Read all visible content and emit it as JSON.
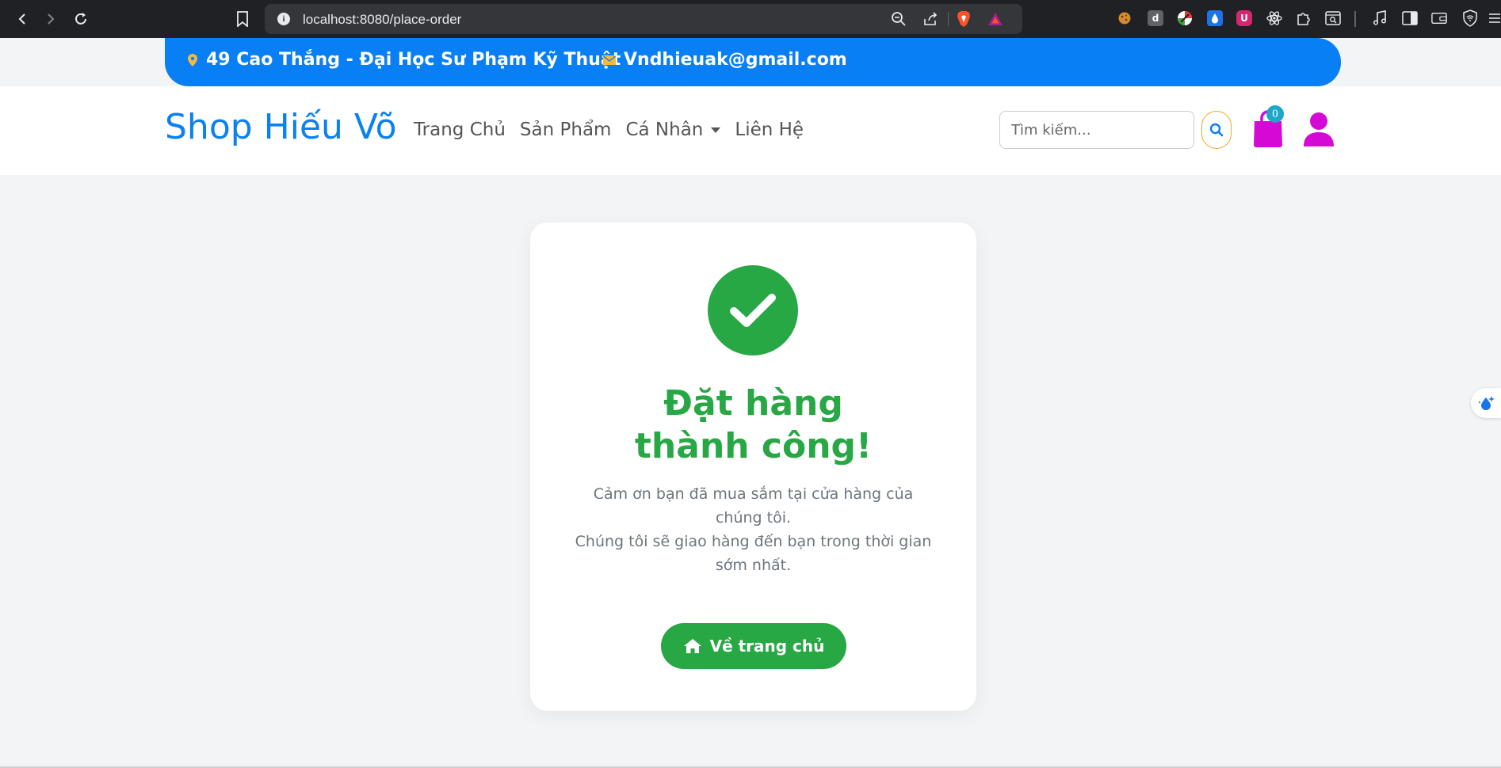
{
  "browser": {
    "url": "localhost:8080/place-order"
  },
  "contact": {
    "address": "49 Cao Thắng - Đại Học Sư Phạm Kỹ Thuật",
    "email": "Vndhieuak@gmail.com"
  },
  "header": {
    "brand": "Shop Hiếu Võ",
    "menu": [
      {
        "label": "Trang Chủ"
      },
      {
        "label": "Sản Phẩm"
      },
      {
        "label": "Cá Nhân"
      },
      {
        "label": "Liên Hệ"
      }
    ],
    "search_placeholder": "Tìm kiếm...",
    "cart_count": "0"
  },
  "order": {
    "title": "Đặt hàng thành công!",
    "message_line1": "Cảm ơn bạn đã mua sắm tại cửa hàng của chúng tôi.",
    "message_line2": "Chúng tôi sẽ giao hàng đến bạn trong thời gian sớm nhất.",
    "home_button": "Về trang chủ"
  },
  "colors": {
    "brand_blue": "#087ff5",
    "success_green": "#28a745",
    "accent_magenta": "#d40ad4"
  },
  "icons": {
    "address": "map-pin-icon",
    "email": "envelope-icon",
    "check": "check-icon",
    "home": "home-icon"
  }
}
